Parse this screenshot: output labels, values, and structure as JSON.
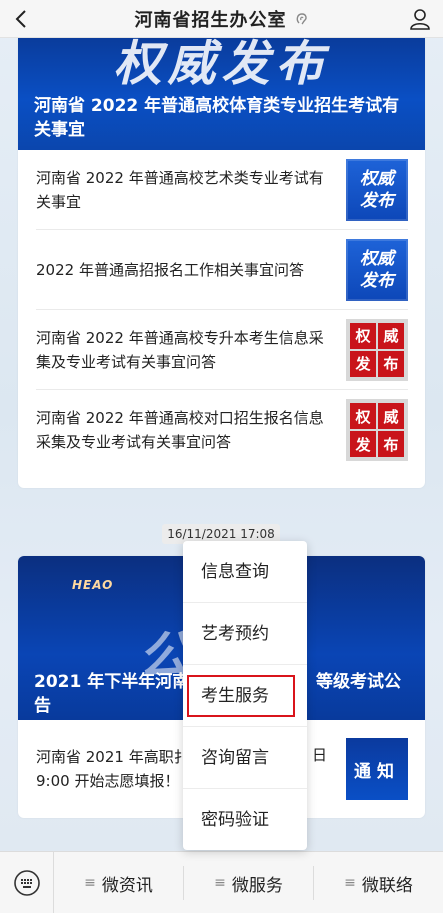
{
  "header": {
    "title": "河南省招生办公室"
  },
  "card1": {
    "banner_big": "权威发布",
    "banner_caption": "河南省 2022 年普通高校体育类专业招生考试有关事宜",
    "items": [
      {
        "text": "河南省 2022 年普通高校艺术类专业考试有关事宜",
        "thumb_line1": "权威",
        "thumb_line2": "发布"
      },
      {
        "text": "2022 年普通高招报名工作相关事宜问答",
        "thumb_line1": "权威",
        "thumb_line2": "发布"
      },
      {
        "text": "河南省 2022 年普通高校专升本考生信息采集及专业考试有关事宜问答",
        "thumb_chars": [
          "权",
          "威",
          "发",
          "布"
        ]
      },
      {
        "text": "河南省 2022 年普通高校对口招生报名信息采集及专业考试有关事宜问答",
        "thumb_chars": [
          "权",
          "威",
          "发",
          "布"
        ]
      }
    ]
  },
  "timestamp": "16/11/2021 17:08",
  "card2": {
    "banner_logo": "HEAO",
    "banner_big": "公",
    "banner_caption": "2021 年下半年河南                                          等级考试公告",
    "banner_caption_left": "2021 年下半年河南",
    "banner_caption_right": "等级考试公",
    "banner_caption_line2": "告",
    "item_text_left": "河南省 2021 年高职扌",
    "item_text_left2": "9:00 开始志愿填报！",
    "item_text_right": "日",
    "thumb": "通知"
  },
  "popup_menu": {
    "items": [
      "信息查询",
      "艺考预约",
      "考生服务",
      "咨询留言",
      "密码验证"
    ],
    "selected_index": 2
  },
  "bottom_bar": {
    "tabs": [
      "微资讯",
      "微服务",
      "微联络"
    ]
  },
  "colors": {
    "banner_blue": "#0a4fc4",
    "highlight_red": "#d9141b",
    "seal_red": "#c9141a"
  },
  "icons": [
    "back-chevron-icon",
    "ear-icon",
    "user-icon",
    "keyboard-icon",
    "menu-lines-icon"
  ]
}
